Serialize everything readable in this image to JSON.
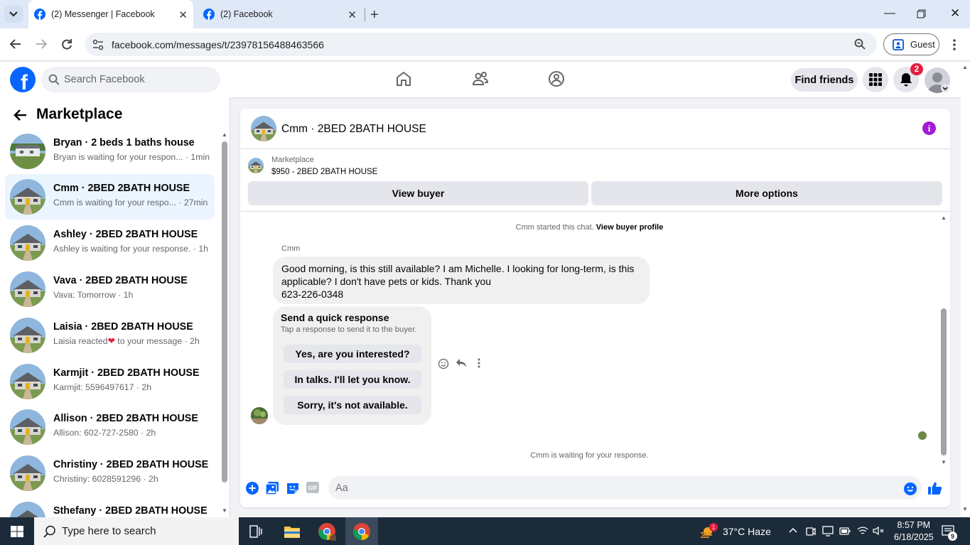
{
  "browser": {
    "tabs": [
      {
        "title": "(2) Messenger | Facebook",
        "active": true
      },
      {
        "title": "(2) Facebook",
        "active": false
      }
    ],
    "url": "facebook.com/messages/t/23978156488463566",
    "profile_label": "Guest"
  },
  "fb_header": {
    "search_placeholder": "Search Facebook",
    "find_friends_label": "Find friends",
    "notification_count": "2"
  },
  "sidebar": {
    "title": "Marketplace",
    "conversations": [
      {
        "name": "Bryan · 2 beds 1 baths house",
        "preview": "Bryan is waiting for your respon... · 1min",
        "selected": false
      },
      {
        "name": "Cmm · 2BED 2BATH HOUSE",
        "preview": "Cmm is waiting for your respo... · 27min",
        "selected": true
      },
      {
        "name": "Ashley · 2BED 2BATH HOUSE",
        "preview": "Ashley is waiting for your response. · 1h",
        "selected": false
      },
      {
        "name": "Vava · 2BED 2BATH HOUSE",
        "preview": "Vava: Tomorrow · 1h",
        "selected": false
      },
      {
        "name": "Laisia · 2BED 2BATH HOUSE",
        "preview_before": "Laisia reacted",
        "preview_after": " to your message · 2h",
        "selected": false
      },
      {
        "name": "Karmjit · 2BED 2BATH HOUSE",
        "preview": "Karmjit: 5596497617 · 2h",
        "selected": false
      },
      {
        "name": "Allison · 2BED 2BATH HOUSE",
        "preview": "Allison: 602-727-2580 · 2h",
        "selected": false
      },
      {
        "name": "Christiny · 2BED 2BATH HOUSE",
        "preview": "Christiny: 6028591296 · 2h",
        "selected": false
      },
      {
        "name": "Sthefany · 2BED 2BATH HOUSE",
        "preview": "",
        "selected": false
      }
    ]
  },
  "chat": {
    "title": "Cmm · 2BED 2BATH HOUSE",
    "marketplace_label": "Marketplace",
    "listing": "$950 - 2BED 2BATH HOUSE",
    "view_buyer_label": "View buyer",
    "more_options_label": "More options",
    "started_text": "Cmm started this chat.",
    "view_buyer_profile_label": "View buyer profile",
    "sender_name": "Cmm",
    "message_line1": "Good morning, is this still available? I am Michelle. I looking for long-term, is this",
    "message_line2": "applicable? I don't have pets or kids. Thank you",
    "message_line3": "623-226-0348",
    "quick_response_title": "Send a quick response",
    "quick_response_subtitle": "Tap a response to send it to the buyer.",
    "quick_responses": [
      "Yes, are you interested?",
      "In talks. I'll let you know.",
      "Sorry, it's not available."
    ],
    "waiting_text": "Cmm is waiting for your response.",
    "composer_placeholder": "Aa"
  },
  "taskbar": {
    "search_placeholder": "Type here to search",
    "weather": "37°C  Haze",
    "time": "8:57 PM",
    "date": "6/18/2025",
    "notification_count": "9",
    "weather_badge": "1"
  },
  "colors": {
    "fb_blue": "#0866ff",
    "selected_bg": "#ebf5ff",
    "badge_red": "#e41e3f",
    "info_purple": "#a11cd4"
  }
}
